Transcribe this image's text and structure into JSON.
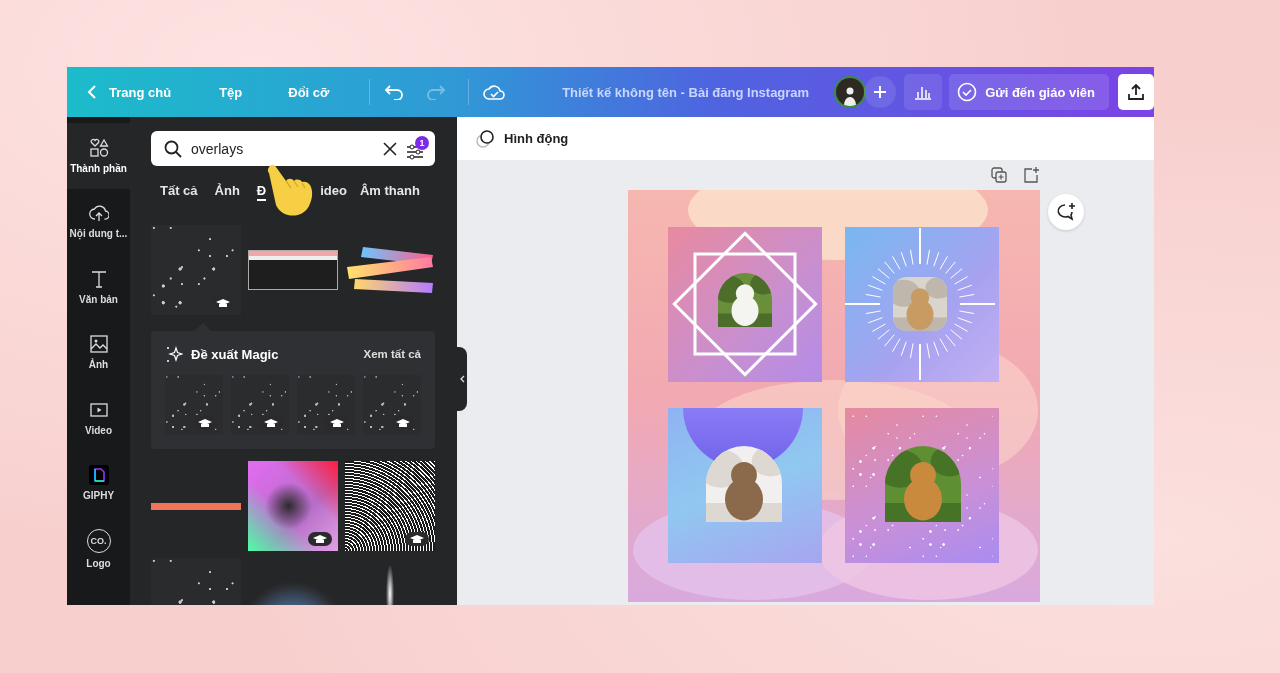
{
  "topbar": {
    "back_label": "Trang chủ",
    "menu": [
      "Tệp",
      "Đổi cỡ"
    ],
    "undo_disabled": false,
    "redo_disabled": true,
    "title": "Thiết kế không tên - Bài đăng Instagram",
    "share_button": "Gửi đến giáo viên"
  },
  "sidebar": {
    "items": [
      {
        "kind": "elements",
        "label": "Thành phần",
        "selected": true
      },
      {
        "kind": "uploads",
        "label": "Nội dung t...",
        "selected": false
      },
      {
        "kind": "text",
        "label": "Văn bản",
        "selected": false
      },
      {
        "kind": "photos",
        "label": "Ảnh",
        "selected": false
      },
      {
        "kind": "videos",
        "label": "Video",
        "selected": false
      },
      {
        "kind": "giphy",
        "label": "GIPHY",
        "selected": false
      },
      {
        "kind": "logo",
        "label": "Logo",
        "icon_text": "CO.",
        "selected": false
      }
    ]
  },
  "search": {
    "value": "overlays",
    "filter_badge": "1"
  },
  "tabs": [
    {
      "label": "Tất cả",
      "selected": false
    },
    {
      "label": "Ảnh",
      "selected": false
    },
    {
      "label": "Đ",
      "selected": true
    },
    {
      "label": "ideo",
      "selected": false
    },
    {
      "label": "Âm thanh",
      "selected": false
    }
  ],
  "results": [
    {
      "kind": "sparkles",
      "premium": true
    },
    {
      "kind": "window",
      "premium": false
    },
    {
      "kind": "tape",
      "premium": false
    },
    {
      "kind": "line",
      "premium": false
    },
    {
      "kind": "gradient",
      "premium": true
    },
    {
      "kind": "rays",
      "premium": true
    },
    {
      "kind": "sparkles"
    },
    {
      "kind": "glow"
    },
    {
      "kind": "spotlight"
    }
  ],
  "magic": {
    "title": "Đề xuất Magic",
    "link": "Xem tất cả",
    "items": [
      {
        "premium": true
      },
      {
        "premium": true
      },
      {
        "premium": true
      },
      {
        "premium": true
      }
    ]
  },
  "toolbar": {
    "animate_button": "Hình động"
  },
  "design": {
    "tiles": [
      {
        "kind": "squares"
      },
      {
        "kind": "starburst"
      },
      {
        "kind": "half-circle"
      },
      {
        "kind": "sparkles"
      }
    ]
  }
}
